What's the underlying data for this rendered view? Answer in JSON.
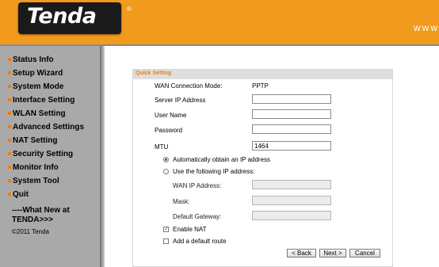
{
  "header": {
    "logo": "Tenda",
    "logo_mark": "®",
    "url_fragment": "www"
  },
  "sidebar": {
    "items": [
      {
        "label": "Status Info"
      },
      {
        "label": "Setup Wizard"
      },
      {
        "label": "System Mode"
      },
      {
        "label": "Interface Setting"
      },
      {
        "label": "WLAN Setting"
      },
      {
        "label": "Advanced Settings"
      },
      {
        "label": "NAT Setting"
      },
      {
        "label": "Security Setting"
      },
      {
        "label": "Monitor Info"
      },
      {
        "label": "System Tool"
      },
      {
        "label": "Quit"
      }
    ],
    "whats_new_line1": "----What New at",
    "whats_new_line2": "TENDA>>>",
    "copyright": "©2011 Tenda"
  },
  "panel": {
    "title": "Quick Setting",
    "wan_mode_label": "WAN Connection Mode:",
    "wan_mode_value": "PPTP",
    "server_ip_label": "Server IP Address",
    "server_ip_value": "",
    "username_label": "User Name",
    "username_value": "",
    "password_label": "Password",
    "password_value": "",
    "mtu_label": "MTU",
    "mtu_value": "1464",
    "radio_auto_label": "Automatically obtain an IP address",
    "radio_auto_selected": true,
    "radio_static_label": "Use the following IP address:",
    "wan_ip_label": "WAN IP Address:",
    "mask_label": "Mask:",
    "gateway_label": "Default Gateway:",
    "enable_nat_label": "Enable NAT",
    "enable_nat_checked": true,
    "default_route_label": "Add a default route",
    "default_route_checked": false,
    "back_label": "< Back",
    "next_label": "Next >",
    "cancel_label": "Cancel"
  },
  "colors": {
    "header": "#f29a1e",
    "sidebar": "#a9a9a9",
    "accent": "#e8800e"
  }
}
